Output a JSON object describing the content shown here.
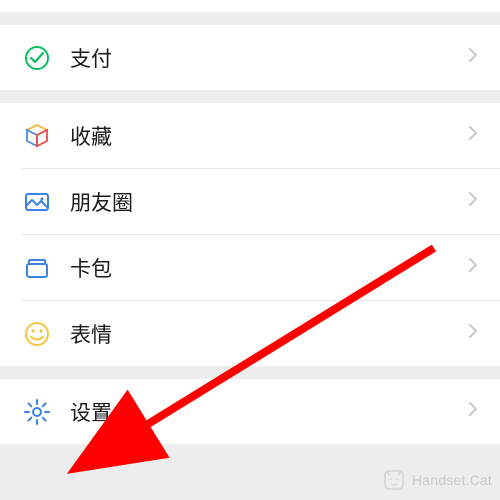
{
  "groups": [
    {
      "items": [
        {
          "id": "pay",
          "label": "支付",
          "icon": "pay-icon",
          "color": "#07c160"
        }
      ]
    },
    {
      "items": [
        {
          "id": "favorites",
          "label": "收藏",
          "icon": "cube-icon",
          "color": "multi"
        },
        {
          "id": "moments",
          "label": "朋友圈",
          "icon": "photo-icon",
          "color": "#3d83e6"
        },
        {
          "id": "cards",
          "label": "卡包",
          "icon": "wallet-icon",
          "color": "#3d83e6"
        },
        {
          "id": "stickers",
          "label": "表情",
          "icon": "smile-icon",
          "color": "#f5c443"
        }
      ]
    },
    {
      "items": [
        {
          "id": "settings",
          "label": "设置",
          "icon": "gear-icon",
          "color": "#3d83e6"
        }
      ]
    }
  ],
  "watermark": "Handset.Cat",
  "annotation": {
    "type": "arrow",
    "target": "settings"
  }
}
